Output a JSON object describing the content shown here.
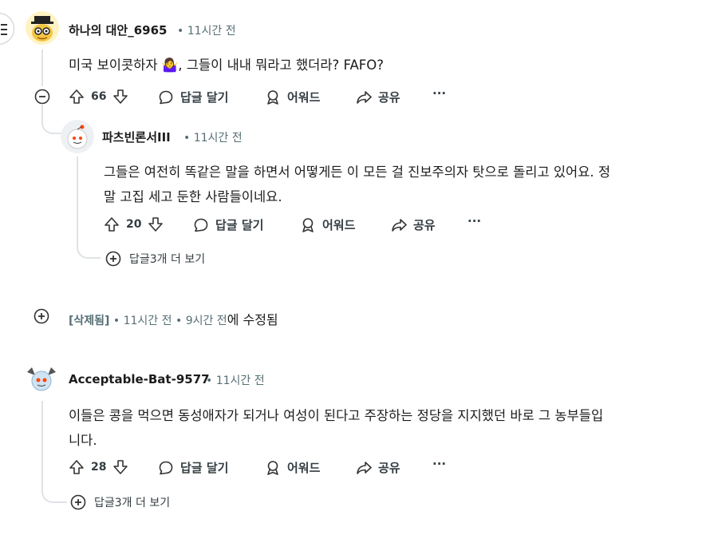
{
  "comments": [
    {
      "username": "하나의 대안_6965",
      "time": "11시간 전",
      "text": "미국 보이콧하자 🤷‍♀️, 그들이 내내 뭐라고 했더라? FAFO?",
      "votes": "66",
      "reply_label": "답글 달기",
      "award_label": "어워드",
      "share_label": "공유",
      "more_label": "···"
    },
    {
      "username": "파츠빈론서III",
      "time": "11시간 전",
      "text_line1": "그들은 여전히 똑같은 말을 하면서 어떻게든 이 모든 걸 진보주의자 탓으로 돌리고 있어요. 정",
      "text_line2": "말 고집 세고 둔한 사람들이네요.",
      "votes": "20",
      "reply_label": "답글 달기",
      "award_label": "어워드",
      "share_label": "공유",
      "more_label": "···",
      "more_replies": "답글3개 더 보기"
    },
    {
      "deleted_label": "[삭제됨]",
      "time": "11시간 전",
      "edited_time": "9시간 전",
      "edited_suffix": "에 수정됨"
    },
    {
      "username": "Acceptable-Bat-9577",
      "time": "11시간 전",
      "text_line1": "이들은 콩을 먹으면 동성애자가 되거나 여성이 된다고 주장하는 정당을 지지했던 바로 그 농부들입",
      "text_line2": "니다.",
      "votes": "28",
      "reply_label": "답글 달기",
      "award_label": "어워드",
      "share_label": "공유",
      "more_label": "···",
      "more_replies": "답글3개 더 보기"
    }
  ],
  "separator": "•",
  "colors": {
    "meta": "#576f76",
    "thread_line": "#dfe3e6",
    "text": "#1c1c1c"
  }
}
